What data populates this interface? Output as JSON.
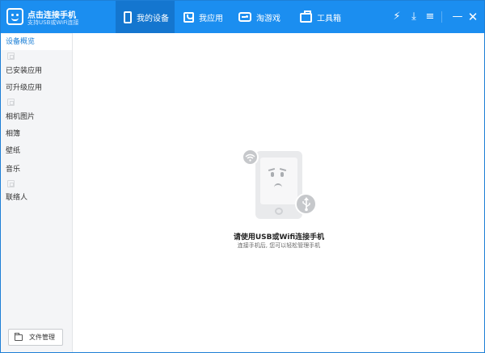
{
  "app": {
    "title": "点击连接手机",
    "subtitle": "支持USB或WiFi连接"
  },
  "nav": {
    "tabs": [
      {
        "label": "我的设备",
        "icon": "phone-icon",
        "active": true
      },
      {
        "label": "我应用",
        "icon": "shopping-bag-icon",
        "active": false
      },
      {
        "label": "淘游戏",
        "icon": "gamepad-icon",
        "active": false
      },
      {
        "label": "工具箱",
        "icon": "toolbox-icon",
        "active": false
      }
    ]
  },
  "controls": {
    "bolt": "⚡",
    "download": "⤓",
    "menu": "≡",
    "minimize": "—",
    "close": "✕"
  },
  "sidebar": {
    "items": [
      {
        "label": "设备概览",
        "active": true
      },
      {
        "label": "已安装应用"
      },
      {
        "label": "可升级应用"
      },
      {
        "label": "相机图片"
      },
      {
        "label": "相簿"
      },
      {
        "label": "壁纸"
      },
      {
        "label": "音乐"
      },
      {
        "label": "联络人"
      }
    ],
    "file_manager_label": "文件管理"
  },
  "empty_state": {
    "title": "请使用USB或Wifi连接手机",
    "subtitle": "连接手机后, 您可以轻松管理手机"
  },
  "colors": {
    "accent": "#1b8ef0",
    "accent_dark": "#1476cf"
  }
}
